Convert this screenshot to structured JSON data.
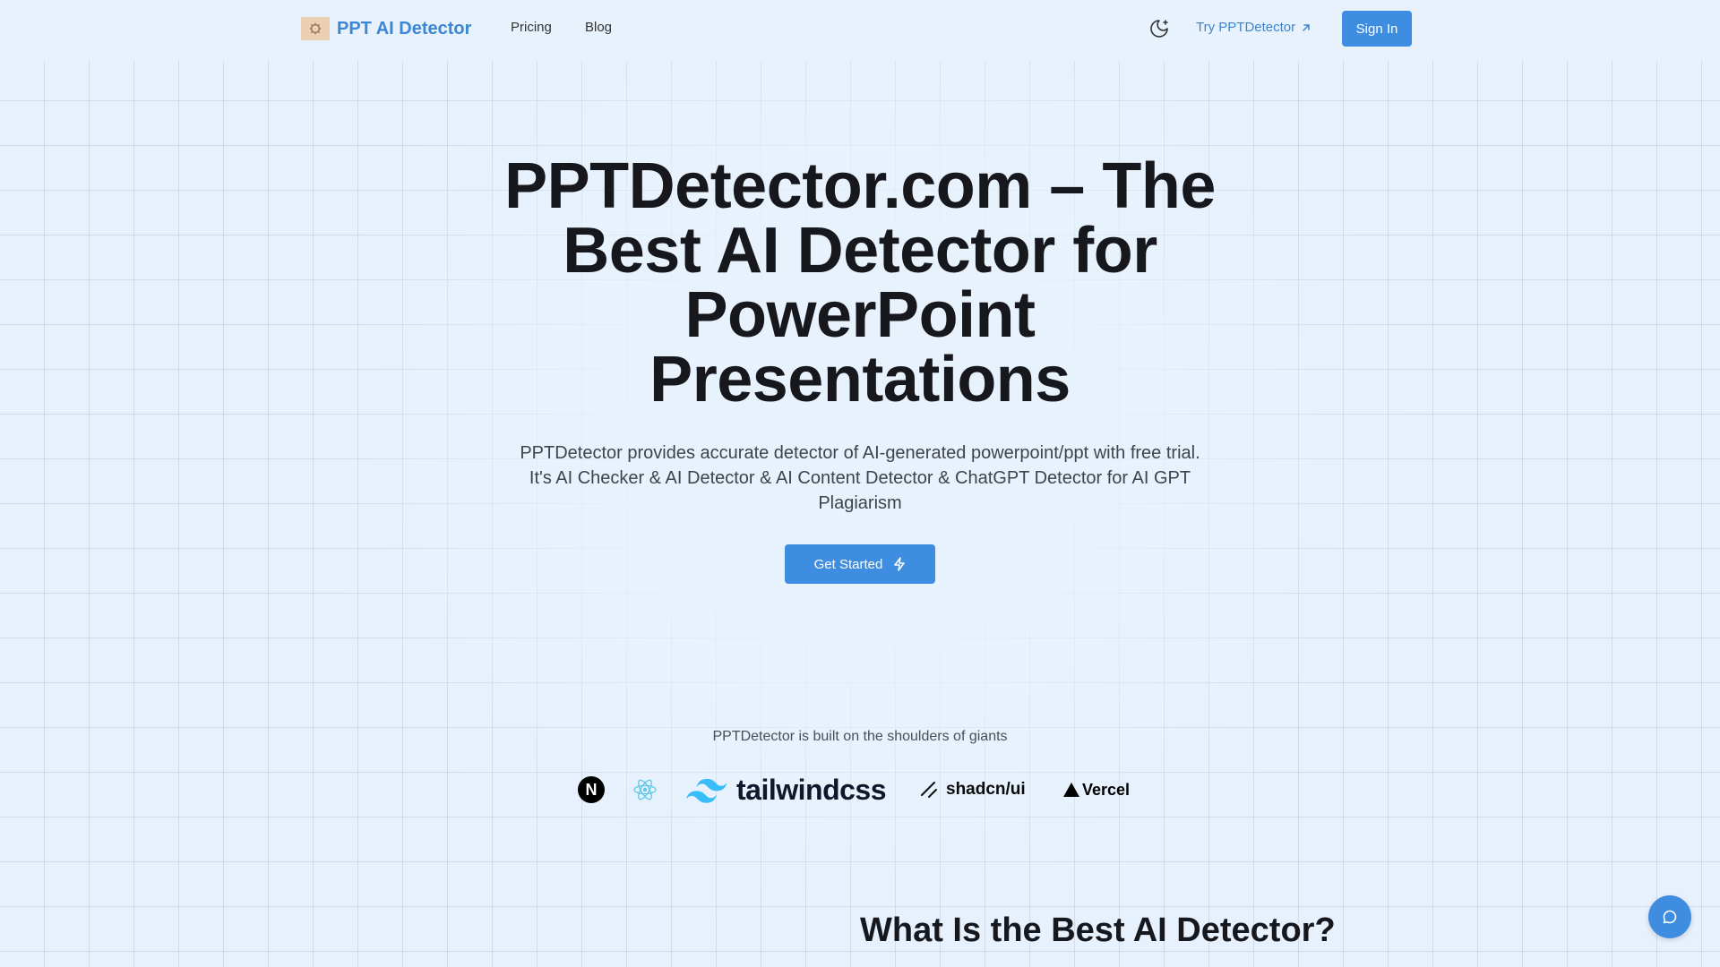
{
  "colors": {
    "accent": "#3e8de0",
    "brand_text": "#3b86d6",
    "background": "#e8f2fd",
    "heading": "#16181d"
  },
  "nav": {
    "brand_icon": "brand-logo-icon",
    "brand_name": "PPT AI Detector",
    "links": [
      "Pricing",
      "Blog"
    ],
    "theme_toggle_icon": "moon-icon",
    "try_link": "Try PPTDetector",
    "try_link_icon": "arrow-up-right-icon",
    "sign_in": "Sign In"
  },
  "hero": {
    "title": "PPTDetector.com – The Best AI Detector for PowerPoint Presentations",
    "subtitle": "PPTDetector provides accurate detector of AI-generated powerpoint/ppt with free trial. It's AI Checker & AI Detector & AI Content Detector & ChatGPT Detector for AI GPT Plagiarism",
    "cta_label": "Get Started",
    "cta_icon": "lightning-icon"
  },
  "giants": {
    "label": "PPTDetector is built on the shoulders of giants",
    "logos": [
      {
        "icon": "nextjs-icon",
        "text": "N"
      },
      {
        "icon": "react-icon",
        "text": ""
      },
      {
        "icon": "tailwind-icon",
        "text": "tailwindcss"
      },
      {
        "icon": "shadcn-icon",
        "text": "shadcn/ui"
      },
      {
        "icon": "vercel-icon",
        "text": "Vercel"
      }
    ]
  },
  "section": {
    "title": "What Is the Best AI Detector?"
  },
  "chat": {
    "icon": "chat-bubble-icon"
  }
}
